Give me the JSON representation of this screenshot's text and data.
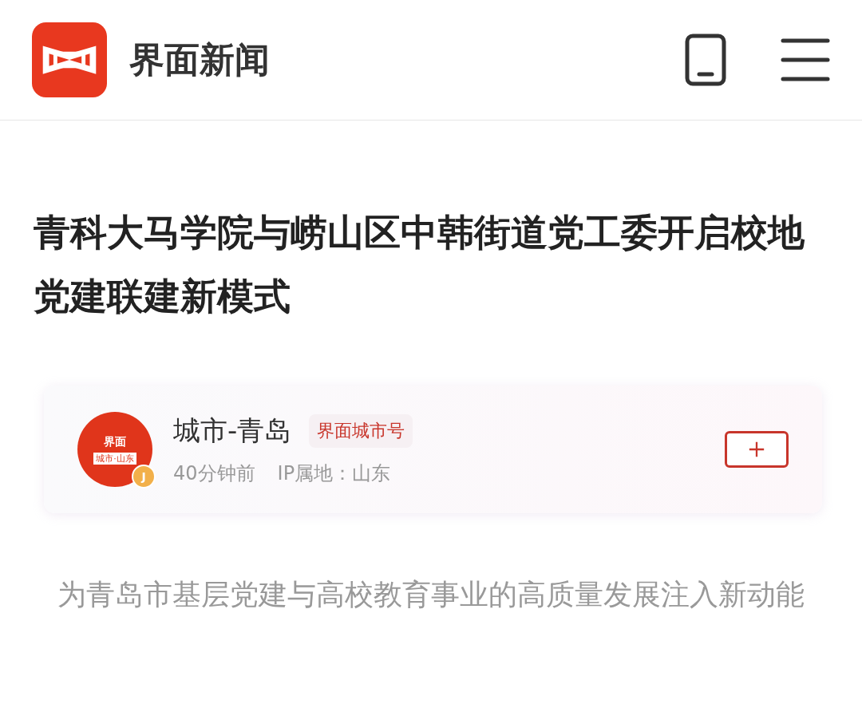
{
  "header": {
    "brand": "界面新闻"
  },
  "article": {
    "title": "青科大马学院与崂山区中韩街道党工委开启校地党建联建新模式"
  },
  "author": {
    "avatar_top": "界面",
    "avatar_bottom": "城市·山东",
    "badge": "J",
    "name": "城市-青岛",
    "tag": "界面城市号",
    "time": "40分钟前",
    "ip": "IP属地：山东",
    "followed": false
  },
  "summary": "为青岛市基层党建与高校教育事业的高质量发展注入新动能"
}
